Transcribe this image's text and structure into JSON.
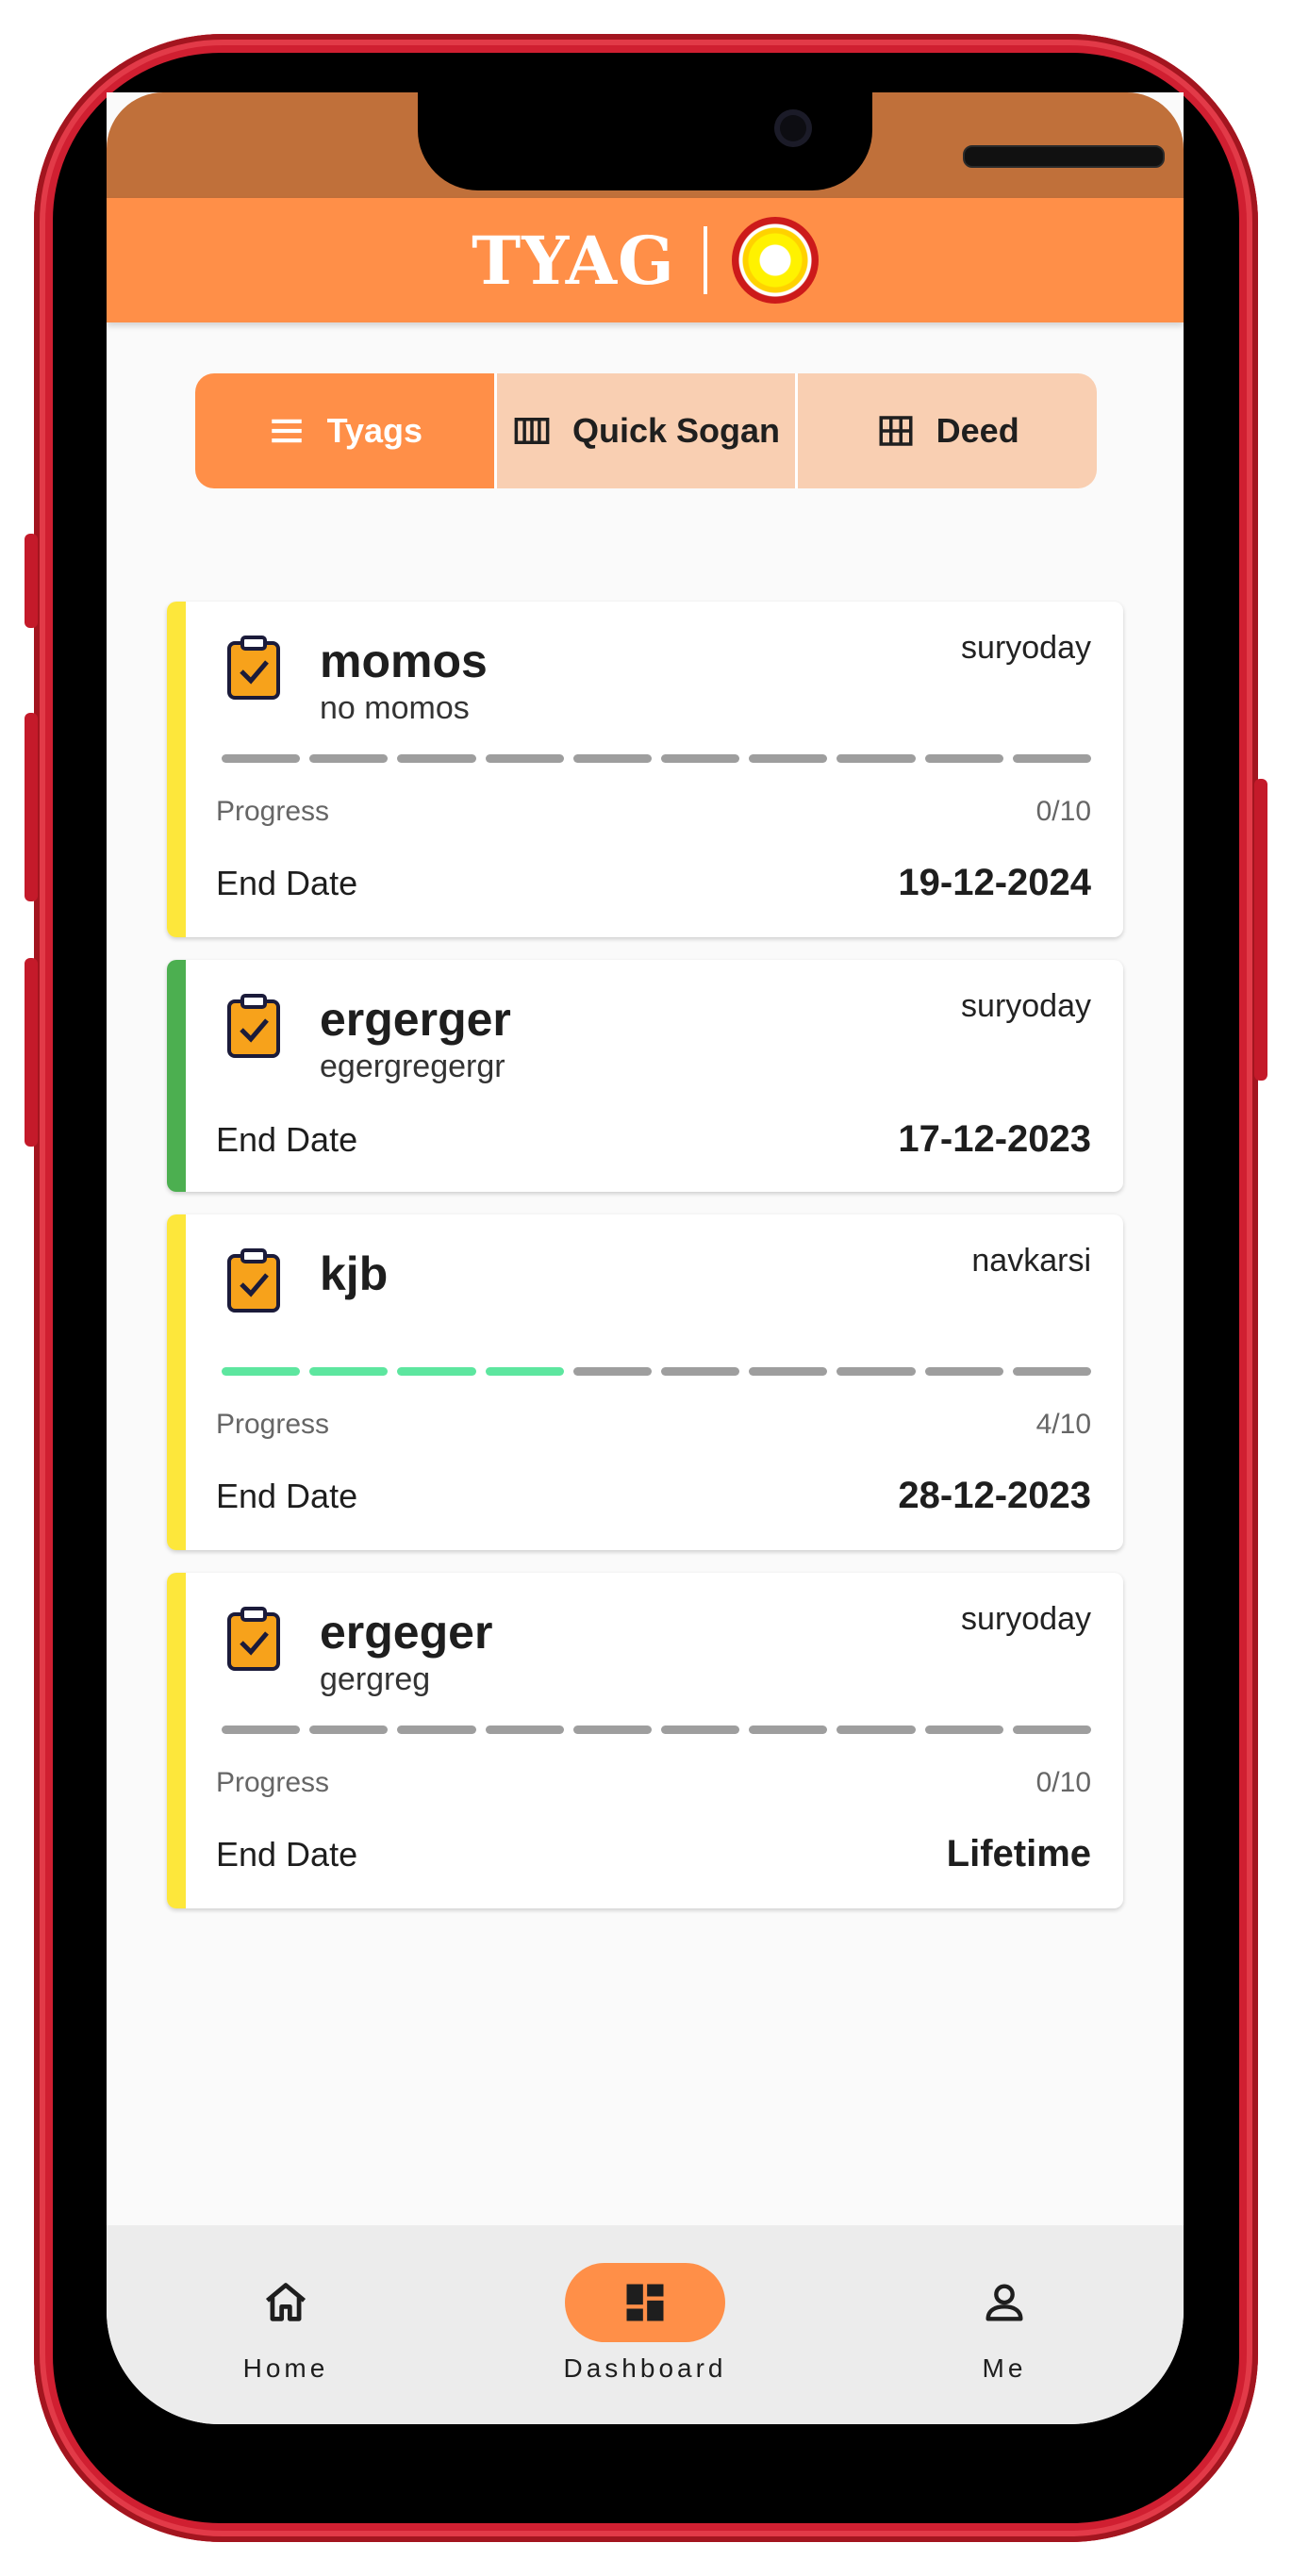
{
  "header": {
    "brand": "TYAG",
    "logo_icon": "concentric-circle-logo-icon"
  },
  "tabs": [
    {
      "label": "Tyags",
      "icon": "list-icon",
      "active": true
    },
    {
      "label": "Quick Sogan",
      "icon": "columns-icon",
      "active": false
    },
    {
      "label": "Deed",
      "icon": "grid-icon",
      "active": false
    }
  ],
  "cards": [
    {
      "title": "momos",
      "subtitle": "no momos",
      "tag": "suryoday",
      "stripe_color": "#fde73b",
      "progress_label": "Progress",
      "progress_value": "0/10",
      "progress_done": 0,
      "progress_total": 10,
      "end_label": "End Date",
      "end_value": "19-12-2024"
    },
    {
      "title": "ergerger",
      "subtitle": "egergregergr",
      "tag": "suryoday",
      "stripe_color": "#4caf50",
      "end_label": "End Date",
      "end_value": "17-12-2023"
    },
    {
      "title": "kjb",
      "subtitle": "",
      "tag": "navkarsi",
      "stripe_color": "#fde73b",
      "progress_label": "Progress",
      "progress_value": "4/10",
      "progress_done": 4,
      "progress_total": 10,
      "end_label": "End Date",
      "end_value": "28-12-2023"
    },
    {
      "title": "ergeger",
      "subtitle": "gergreg",
      "tag": "suryoday",
      "stripe_color": "#fde73b",
      "progress_label": "Progress",
      "progress_value": "0/10",
      "progress_done": 0,
      "progress_total": 10,
      "end_label": "End Date",
      "end_value": "Lifetime"
    }
  ],
  "nav": [
    {
      "label": "Home",
      "icon": "home-icon",
      "active": false
    },
    {
      "label": "Dashboard",
      "icon": "dashboard-icon",
      "active": true
    },
    {
      "label": "Me",
      "icon": "person-icon",
      "active": false
    }
  ],
  "colors": {
    "accent": "#ff8f48",
    "accent_light": "#f9cfb2",
    "progress_done": "#5de69f",
    "progress_pending": "#9e9e9e"
  }
}
